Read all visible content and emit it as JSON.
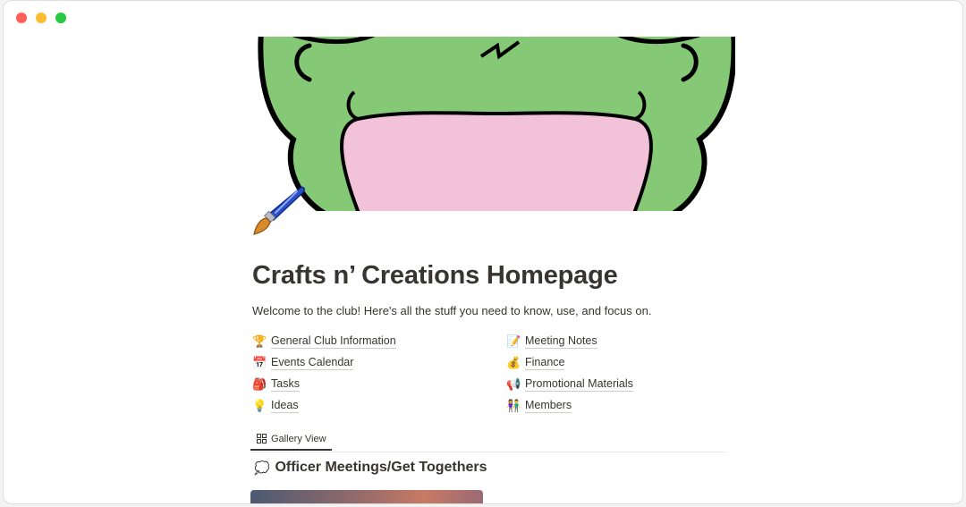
{
  "page": {
    "title": "Crafts n’ Creations Homepage",
    "description": "Welcome to the club! Here's all the stuff you need to know, use, and focus on.",
    "icon": "paintbrush-icon"
  },
  "links": {
    "left": [
      {
        "icon": "trophy-icon",
        "emoji": "🏆",
        "label": "General Club Information"
      },
      {
        "icon": "calendar-icon",
        "emoji": "📅",
        "label": "Events Calendar"
      },
      {
        "icon": "backpack-icon",
        "emoji": "🎒",
        "label": "Tasks"
      },
      {
        "icon": "lightbulb-icon",
        "emoji": "💡",
        "label": "Ideas"
      }
    ],
    "right": [
      {
        "icon": "memo-icon",
        "emoji": "📝",
        "label": "Meeting Notes"
      },
      {
        "icon": "money-bag-icon",
        "emoji": "💰",
        "label": "Finance"
      },
      {
        "icon": "megaphone-icon",
        "emoji": "📢",
        "label": "Promotional Materials"
      },
      {
        "icon": "people-icon",
        "emoji": "👫",
        "label": "Members"
      }
    ]
  },
  "views": {
    "tabs": [
      {
        "icon": "gallery-grid-icon",
        "label": "Gallery View"
      }
    ]
  },
  "section": {
    "icon": "thought-balloon-icon",
    "emoji": "💭",
    "title": "Officer Meetings/Get Togethers"
  },
  "colors": {
    "text": "#37352f",
    "frog_green": "#85c876",
    "mouth_pink": "#f2c2d8",
    "divider": "#e9e9e7"
  }
}
